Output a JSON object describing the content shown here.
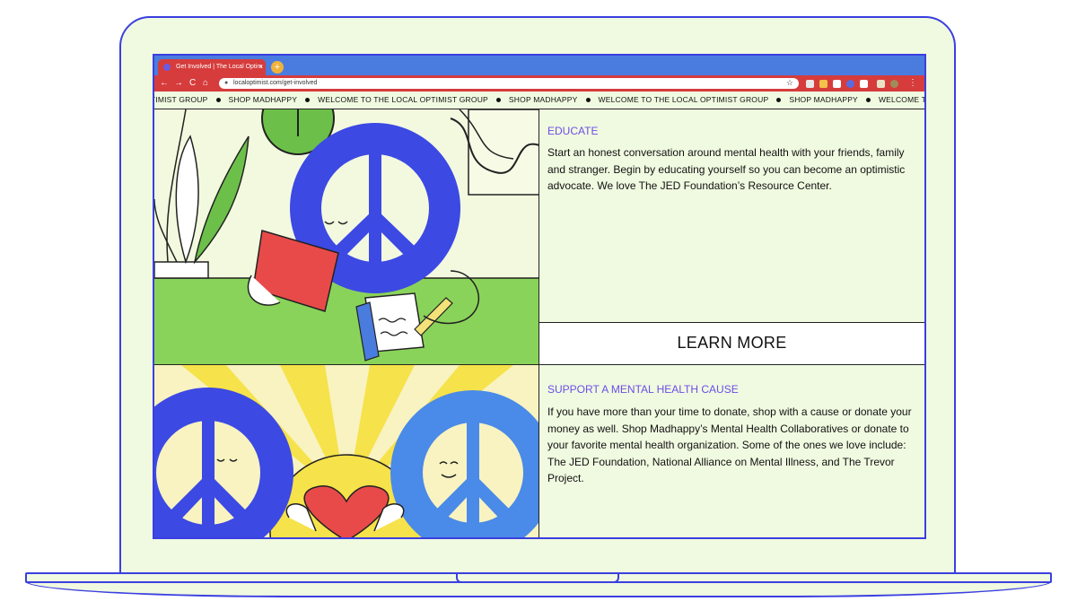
{
  "browser": {
    "tab_title": "Get Involved | The Local Optim",
    "tab_close": "×",
    "new_tab": "+",
    "back": "←",
    "forward": "→",
    "reload": "C",
    "home": "⌂",
    "url": "localoptimist.com/get-involved",
    "menu": "⋮"
  },
  "marquee": {
    "items": [
      "PTIMIST GROUP",
      "SHOP MADHAPPY",
      "WELCOME TO THE LOCAL OPTIMIST GROUP",
      "SHOP MADHAPPY",
      "WELCOME TO THE LOCAL OPTIMIST GROUP",
      "SHOP MADHAPPY",
      "WELCOME TO THE LOCAL OPTIMIST"
    ]
  },
  "sections": [
    {
      "heading": "EDUCATE",
      "body": "Start an honest conversation around mental health with your friends, family and stranger. Begin by educating yourself so you can become an optimistic advocate. We love The JED Foundation’s Resource Center.",
      "button": "LEARN MORE"
    },
    {
      "heading": "SUPPORT A MENTAL HEALTH CAUSE",
      "body": "If you have more than your time to donate, shop with a cause or donate your money as well. Shop Madhappy’s Mental Health Collaboratives or donate to your favorite mental health organization. Some of the ones we love include: The JED Foundation, National Alliance on Mental Illness, and The Trevor Project."
    }
  ],
  "colors": {
    "frame": "#3b3fe0",
    "background": "#f0fae0",
    "accent_heading": "#6a4ee8",
    "tab_bar": "#4a7cdf",
    "address_bar": "#d63c3c"
  }
}
